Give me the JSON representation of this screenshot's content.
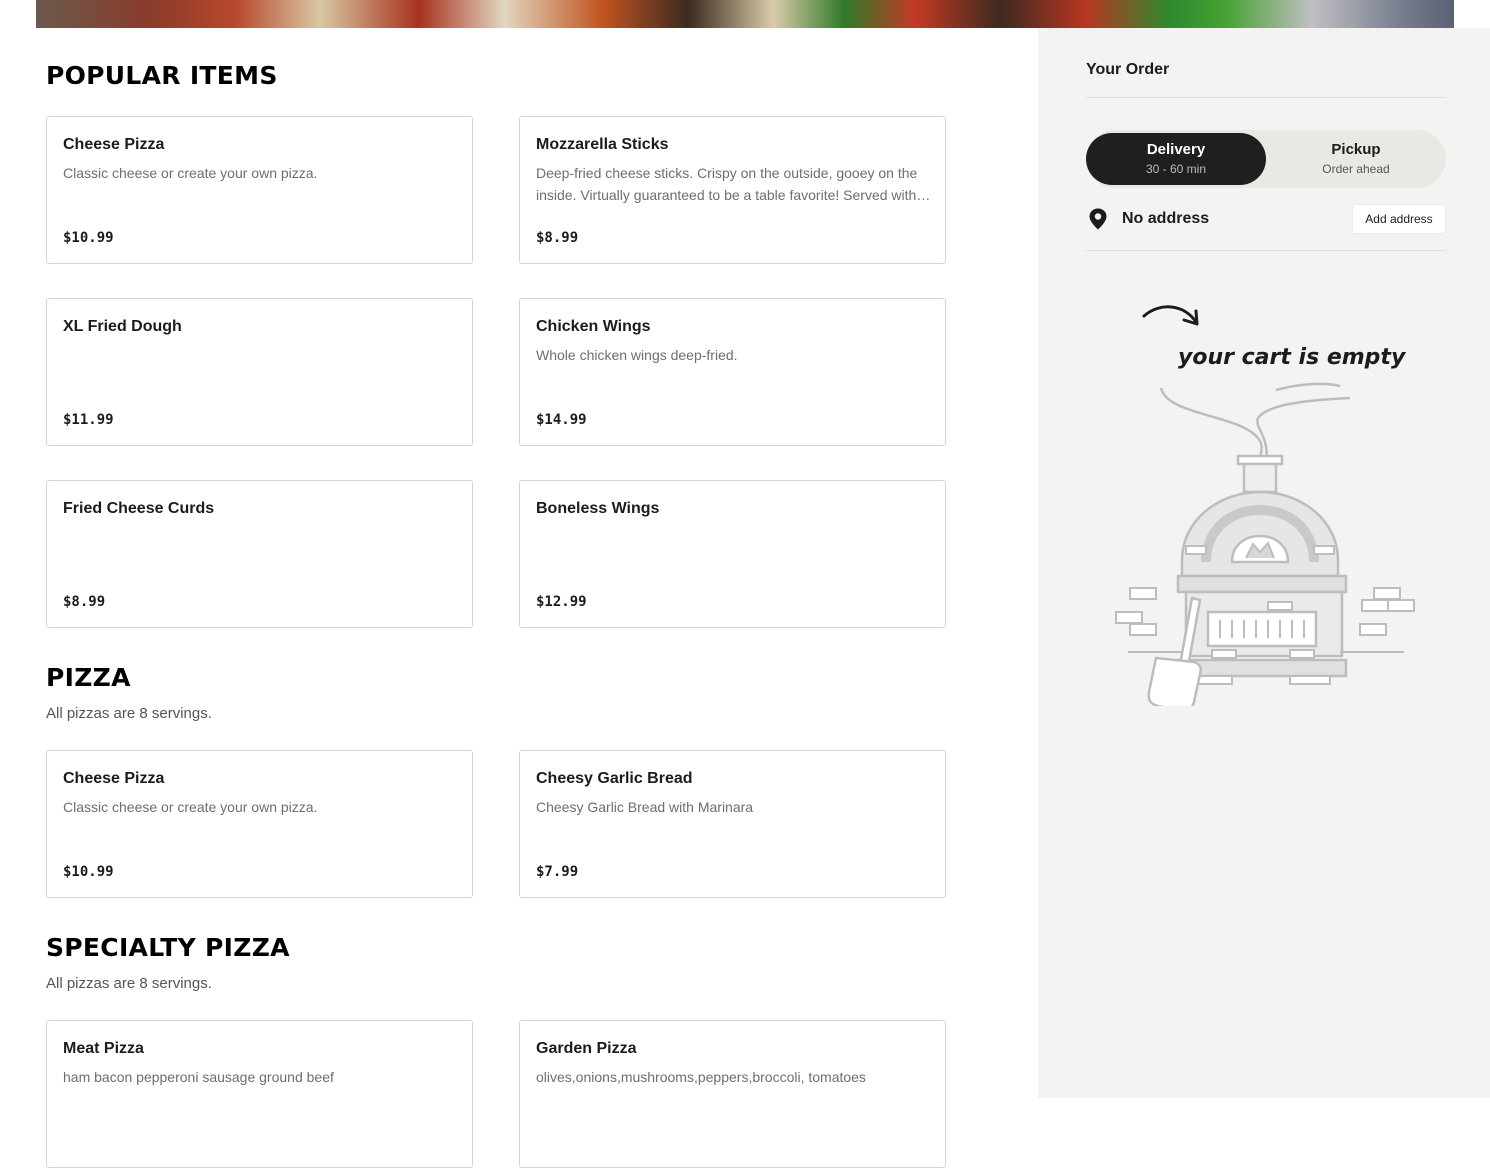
{
  "sections": [
    {
      "title": "POPULAR ITEMS",
      "description": "",
      "items": [
        {
          "name": "Cheese Pizza",
          "description": "Classic cheese or create your own pizza.",
          "price": "$10.99"
        },
        {
          "name": "Mozzarella Sticks",
          "description": "Deep-fried cheese sticks. Crispy on the outside, gooey on the inside. Virtually guaranteed to be a table favorite! Served with marinara.",
          "price": "$8.99"
        },
        {
          "name": "XL Fried Dough",
          "description": "",
          "price": "$11.99"
        },
        {
          "name": "Chicken Wings",
          "description": "Whole chicken wings deep-fried.",
          "price": "$14.99"
        },
        {
          "name": "Fried Cheese Curds",
          "description": "",
          "price": "$8.99"
        },
        {
          "name": "Boneless Wings",
          "description": "",
          "price": "$12.99"
        }
      ]
    },
    {
      "title": "PIZZA",
      "description": "All pizzas are 8 servings.",
      "items": [
        {
          "name": "Cheese Pizza",
          "description": "Classic cheese or create your own pizza.",
          "price": "$10.99"
        },
        {
          "name": "Cheesy Garlic Bread",
          "description": "Cheesy Garlic Bread with Marinara",
          "price": "$7.99"
        }
      ]
    },
    {
      "title": "SPECIALTY PIZZA",
      "description": "All pizzas are 8 servings.",
      "items": [
        {
          "name": "Meat Pizza",
          "description": "ham bacon pepperoni sausage ground beef",
          "price": ""
        },
        {
          "name": "Garden Pizza",
          "description": "olives,onions,mushrooms,peppers,broccoli, tomatoes",
          "price": ""
        }
      ]
    }
  ],
  "order": {
    "title": "Your Order",
    "delivery": {
      "label": "Delivery",
      "sub": "30 - 60 min",
      "selected": true
    },
    "pickup": {
      "label": "Pickup",
      "sub": "Order ahead"
    },
    "address": {
      "text": "No address",
      "button": "Add address",
      "icon": "map-pin-icon"
    },
    "empty_cart": {
      "label": "your cart is empty",
      "illustration": "pizza-oven-illustration",
      "arrow": "curved-arrow-icon"
    }
  },
  "colors": {
    "toggle_active": "#1f1f1f",
    "sidebar_bg": "#f4f3f1",
    "card_border": "#d4d4d4"
  }
}
